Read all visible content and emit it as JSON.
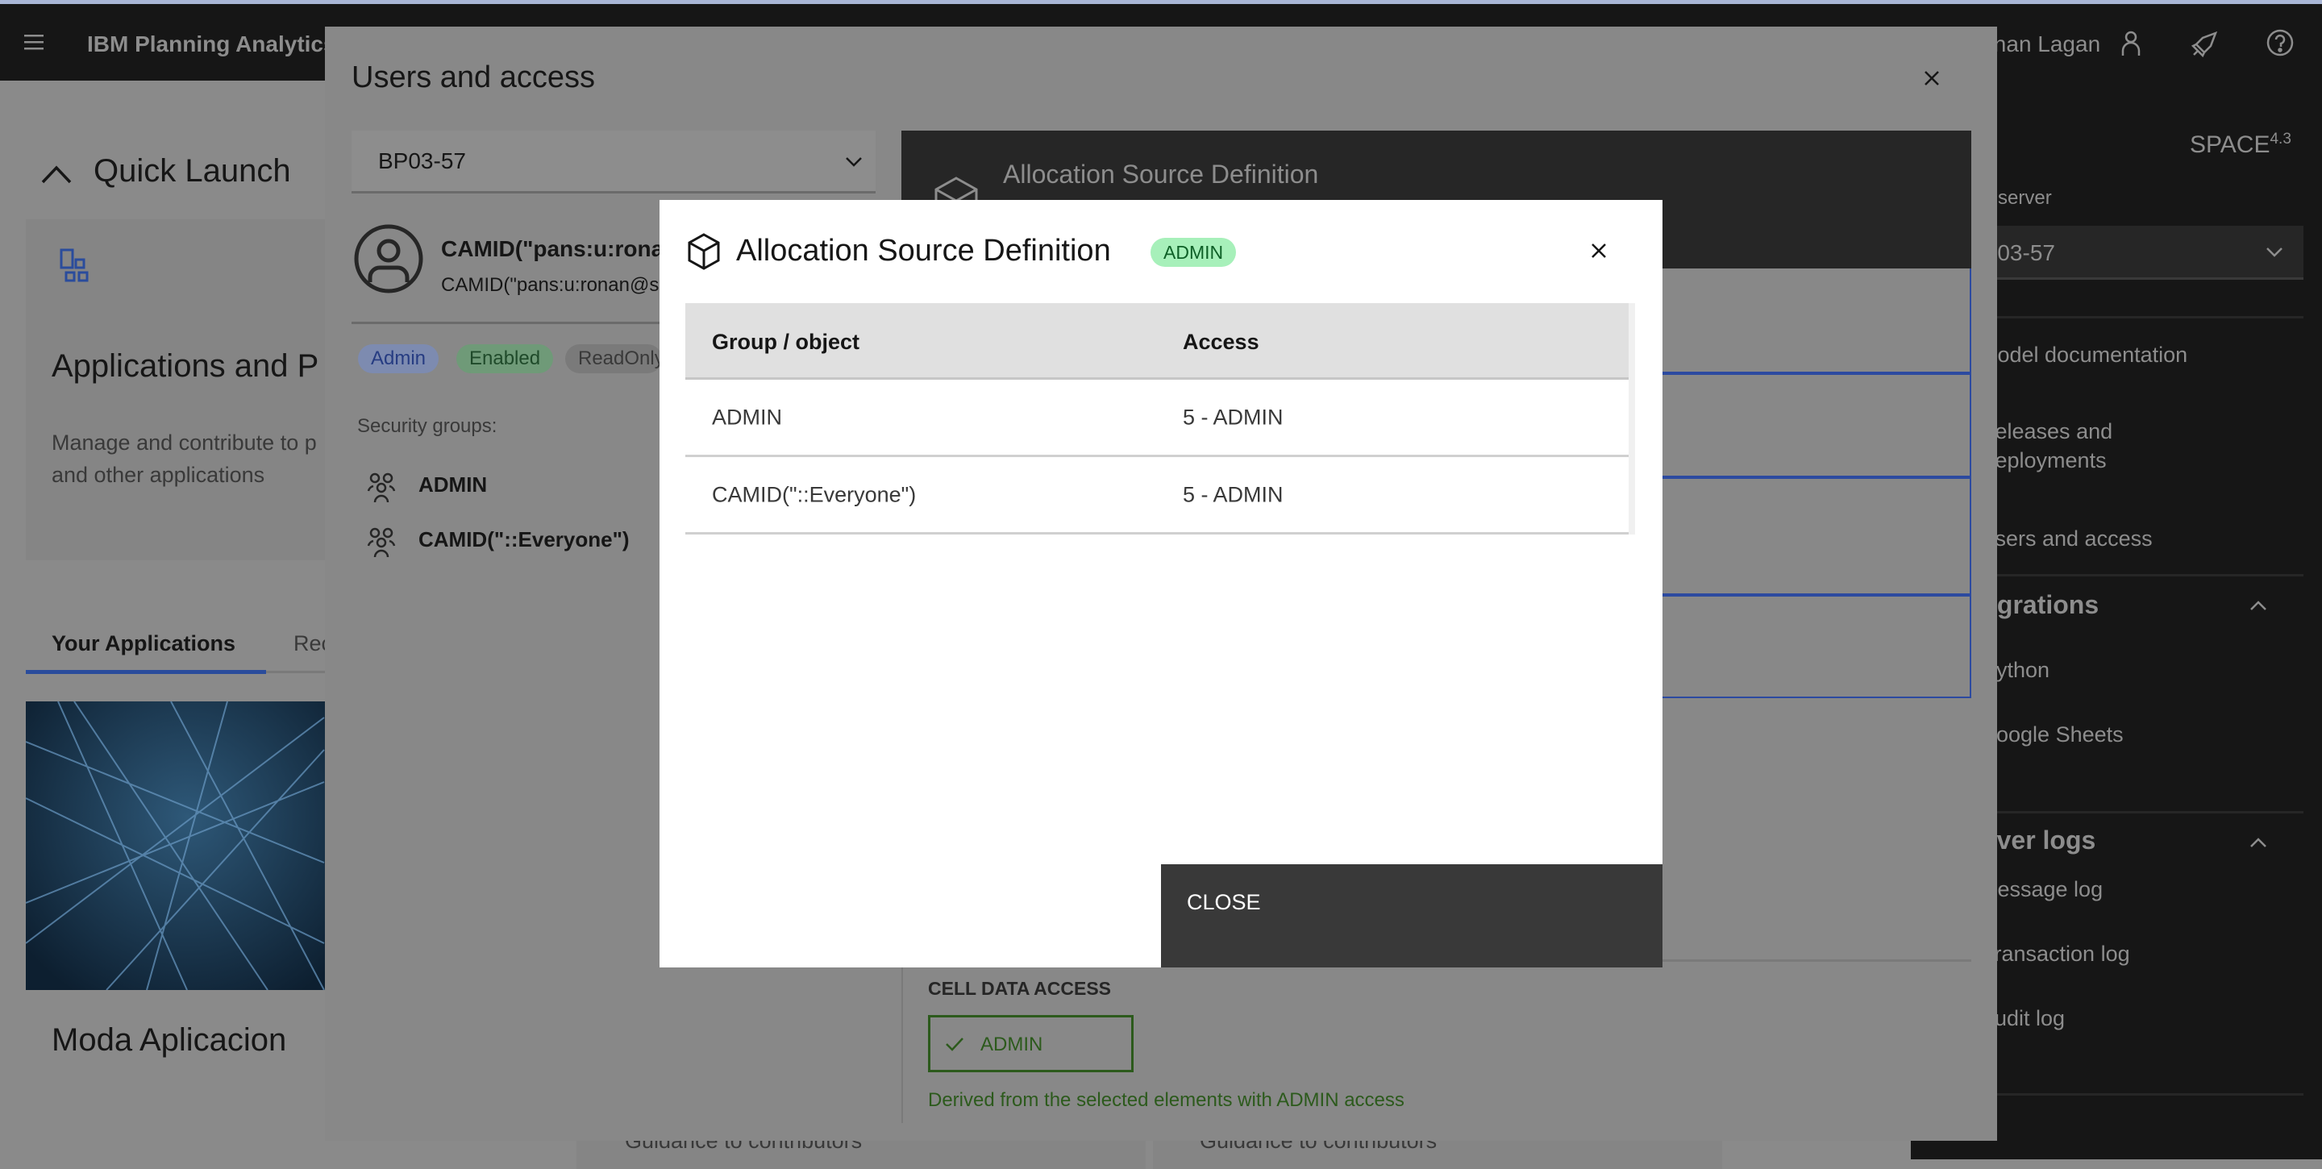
{
  "topbar": {
    "brand": "IBM Planning Analytics",
    "user_name": "Ronan Lagan",
    "icons": [
      "menu-icon",
      "user-icon",
      "rocket-icon",
      "help-icon"
    ]
  },
  "page": {
    "quick_launch": "Quick Launch",
    "card_title": "Applications and P",
    "card_desc_1": "Manage and contribute to p",
    "card_desc_2": "and other applications",
    "tabs": [
      "Your Applications",
      "Rec"
    ],
    "app_name": "Moda Aplicacion",
    "guidance": [
      "Guidance to contributors",
      "Guidance to contributors"
    ]
  },
  "sidebar": {
    "space": "SPACE",
    "space_version": "4.3",
    "server_label": "server",
    "server_value": "BP03-57",
    "items_top": [
      "Model documentation",
      "Releases and",
      "Deployments",
      "Users and access"
    ],
    "integrations": {
      "title": "Integrations",
      "items": [
        "Python",
        "Google Sheets"
      ]
    },
    "server_logs": {
      "title": "Server logs",
      "items": [
        "Message log",
        "Transaction log",
        "Audit log"
      ]
    }
  },
  "users_modal": {
    "title": "Users and access",
    "server_select": "BP03-57",
    "user_name": "CAMID(\"pans:u:ronan",
    "user_email": "CAMID(\"pans:u:ronan@se",
    "tags": [
      {
        "label": "Admin",
        "color": "#7d8bb0"
      },
      {
        "label": "Enabled",
        "color": "#6f9a78"
      },
      {
        "label": "ReadOnlyU",
        "color": "#7a7a7a"
      }
    ],
    "security_groups_label": "Security groups:",
    "security_groups": [
      "ADMIN",
      "CAMID(\"::Everyone\")"
    ],
    "panel_title": "Allocation Source Definition",
    "cell_data_access_label": "CELL DATA ACCESS",
    "cell_data_value": "ADMIN",
    "derived_note": "Derived from the selected elements with ADMIN access"
  },
  "dialog": {
    "title": "Allocation Source Definition",
    "badge": "ADMIN",
    "badge_color": "#a7f0ba",
    "columns": [
      "Group / object",
      "Access"
    ],
    "rows": [
      {
        "group": "ADMIN",
        "access": "5 - ADMIN"
      },
      {
        "group": "CAMID(\"::Everyone\")",
        "access": "5 - ADMIN"
      }
    ],
    "close_button": "CLOSE"
  }
}
